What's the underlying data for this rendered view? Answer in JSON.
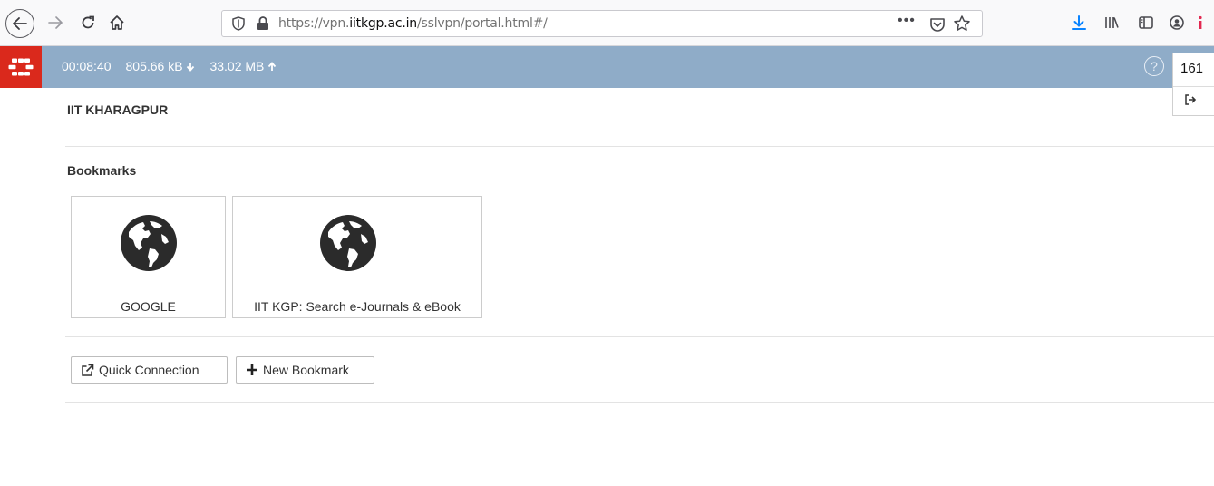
{
  "browser": {
    "url_prefix": "https://vpn.",
    "url_domain": "iitkgp.ac.in",
    "url_path": "/sslvpn/portal.html#/",
    "more_label": "•••"
  },
  "vpn": {
    "duration": "00:08:40",
    "download": "805.66 kB",
    "upload": "33.02 MB",
    "help_label": "?",
    "user_label": "161"
  },
  "portal": {
    "org_name": "IIT KHARAGPUR",
    "bookmarks_title": "Bookmarks",
    "bookmarks": [
      {
        "label": "GOOGLE",
        "icon": "globe-icon"
      },
      {
        "label": "IIT KGP: Search e-Journals & eBook",
        "icon": "globe-icon"
      }
    ],
    "actions": {
      "quick_connection": "Quick Connection",
      "new_bookmark": "New Bookmark"
    }
  },
  "colors": {
    "vpn_bar": "#8facc8",
    "logo_red": "#da291c",
    "download_arrow": "#0a84ff"
  }
}
